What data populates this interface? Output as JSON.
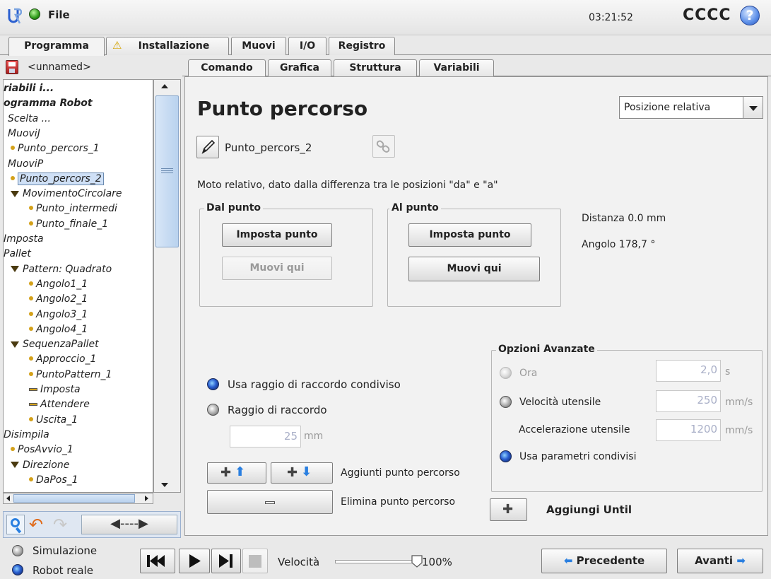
{
  "topbar": {
    "file_label": "File",
    "clock": "03:21:52",
    "robot_name": "CCCC",
    "help_label": "?"
  },
  "main_tabs": [
    "Programma",
    "Installazione",
    "Muovi",
    "I/O",
    "Registro"
  ],
  "program_name": "<unnamed>",
  "tree": [
    {
      "label": "riabili i...",
      "style": "bold"
    },
    {
      "label": "ogramma Robot",
      "style": "bold"
    },
    {
      "label": "Scelta ...",
      "indent": 6
    },
    {
      "label": "MuoviJ",
      "indent": 6
    },
    {
      "label": "Punto_percors_1",
      "indent": 10,
      "type": "dot"
    },
    {
      "label": "MuoviP",
      "indent": 6
    },
    {
      "label": "Punto_percors_2",
      "indent": 10,
      "type": "dot",
      "selected": true
    },
    {
      "label": "MovimentoCircolare",
      "indent": 10,
      "type": "tri"
    },
    {
      "label": "Punto_intermedi",
      "indent": 36,
      "type": "dot"
    },
    {
      "label": "Punto_finale_1",
      "indent": 36,
      "type": "dot"
    },
    {
      "label": "Imposta",
      "indent": 0
    },
    {
      "label": "Pallet",
      "indent": 0
    },
    {
      "label": "Pattern: Quadrato",
      "indent": 10,
      "type": "tri"
    },
    {
      "label": "Angolo1_1",
      "indent": 36,
      "type": "dot"
    },
    {
      "label": "Angolo2_1",
      "indent": 36,
      "type": "dot"
    },
    {
      "label": "Angolo3_1",
      "indent": 36,
      "type": "dot"
    },
    {
      "label": "Angolo4_1",
      "indent": 36,
      "type": "dot"
    },
    {
      "label": "SequenzaPallet",
      "indent": 10,
      "type": "tri"
    },
    {
      "label": "Approccio_1",
      "indent": 36,
      "type": "dot"
    },
    {
      "label": "PuntoPattern_1",
      "indent": 36,
      "type": "dot"
    },
    {
      "label": "Imposta",
      "indent": 36,
      "type": "bar"
    },
    {
      "label": "Attendere",
      "indent": 36,
      "type": "bar"
    },
    {
      "label": "Uscita_1",
      "indent": 36,
      "type": "dot"
    },
    {
      "label": "Disimpila",
      "indent": 0
    },
    {
      "label": "PosAvvio_1",
      "indent": 10,
      "type": "dot"
    },
    {
      "label": "Direzione",
      "indent": 10,
      "type": "tri"
    },
    {
      "label": "DaPos_1",
      "indent": 36,
      "type": "dot"
    }
  ],
  "sub_tabs": [
    "Comando",
    "Grafica",
    "Struttura",
    "Variabili"
  ],
  "content": {
    "title": "Punto percorso",
    "mode_select": "Posizione relativa",
    "waypoint_name": "Punto_percors_2",
    "description": "Moto relativo, dato dalla differenza tra le posizioni \"da\" e \"a\"",
    "from_group": {
      "legend": "Dal punto",
      "set_btn": "Imposta punto",
      "move_btn": "Muovi qui"
    },
    "to_group": {
      "legend": "Al punto",
      "set_btn": "Imposta punto",
      "move_btn": "Muovi qui"
    },
    "distance": "Distanza 0.0 mm",
    "angle": "Angolo 178,7 °",
    "blend_shared": "Usa raggio di raccordo condiviso",
    "blend_radius": "Raggio di raccordo",
    "blend_value": "25",
    "blend_unit": "mm",
    "add_waypoint": "Aggiunti punto percorso",
    "delete_waypoint": "Elimina punto percorso",
    "advanced": {
      "legend": "Opzioni Avanzate",
      "time_label": "Ora",
      "time_value": "2,0",
      "time_unit": "s",
      "speed_label": "Velocità utensile",
      "speed_value": "250",
      "speed_unit": "mm/s",
      "accel_label": "Accelerazione utensile",
      "accel_value": "1200",
      "accel_unit": "mm/s",
      "shared_label": "Usa parametri condivisi"
    },
    "add_until": "Aggiungi Until"
  },
  "bottom": {
    "sim_label": "Simulazione",
    "real_label": "Robot reale",
    "speed_label": "Velocità",
    "speed_value": "100%",
    "speed_fraction": 1.0,
    "prev_label": "Precedente",
    "next_label": "Avanti"
  },
  "colors": {
    "accent_blue": "#2a5fd0",
    "selection": "#cfe0f6"
  }
}
